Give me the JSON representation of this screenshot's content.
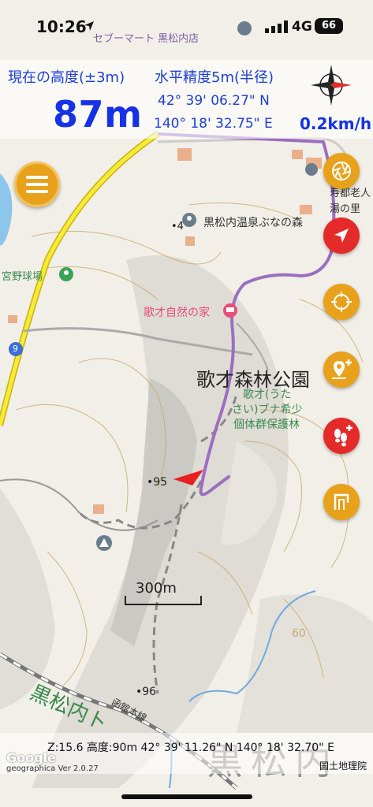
{
  "status_bar": {
    "time": "10:26",
    "network": "4G",
    "battery": "66"
  },
  "info_panel": {
    "altitude_label": "現在の高度(±3m)",
    "altitude_value": "87m",
    "accuracy_label": "水平精度5m(半径)",
    "latitude": "42° 39' 06.27\" N",
    "longitude": "140° 18' 32.75\" E",
    "speed": "0.2km/h"
  },
  "map_labels": {
    "store": "セブーマート 黒松内店",
    "onsen": "黒松内温泉ぶなの森",
    "elderly_home": "寿都老人",
    "elderly_home2": "湯の里",
    "ballpark": "宮野球場",
    "nature_house": "歌才自然の家",
    "forest_park": "歌才森林公園",
    "beech_forest_1": "歌才(うた",
    "beech_forest_2": "さい)ブナ希少",
    "beech_forest_3": "個体群保護林",
    "spot_95": "95",
    "spot_96": "96",
    "spot_4": "4",
    "route_9": "9",
    "contour_60": "60",
    "railway": "函館本線",
    "town_name_large": "黒松内",
    "town_name_green": "黒松内ト"
  },
  "scale": {
    "label": "300m"
  },
  "bottom": {
    "zoom_info": "Z:15.6 高度:90m  42° 39' 11.26\" N 140° 18' 32.70\" E",
    "attribution": "国土地理院",
    "google": "Google",
    "version": "geographica Ver 2.0.27"
  },
  "icons": {
    "menu": "menu-icon",
    "aperture": "aperture-icon",
    "navigate": "navigation-arrow-icon",
    "crosshair": "crosshair-icon",
    "add_waypoint": "add-pin-icon",
    "add_footprint": "add-footprints-icon",
    "flag": "flag-icon",
    "compass": "compass-icon"
  },
  "colors": {
    "accent_orange": "#e8a11b",
    "accent_red": "#e52a2a",
    "text_blue": "#1c3fd4",
    "track_purple": "#9b6fc0"
  }
}
